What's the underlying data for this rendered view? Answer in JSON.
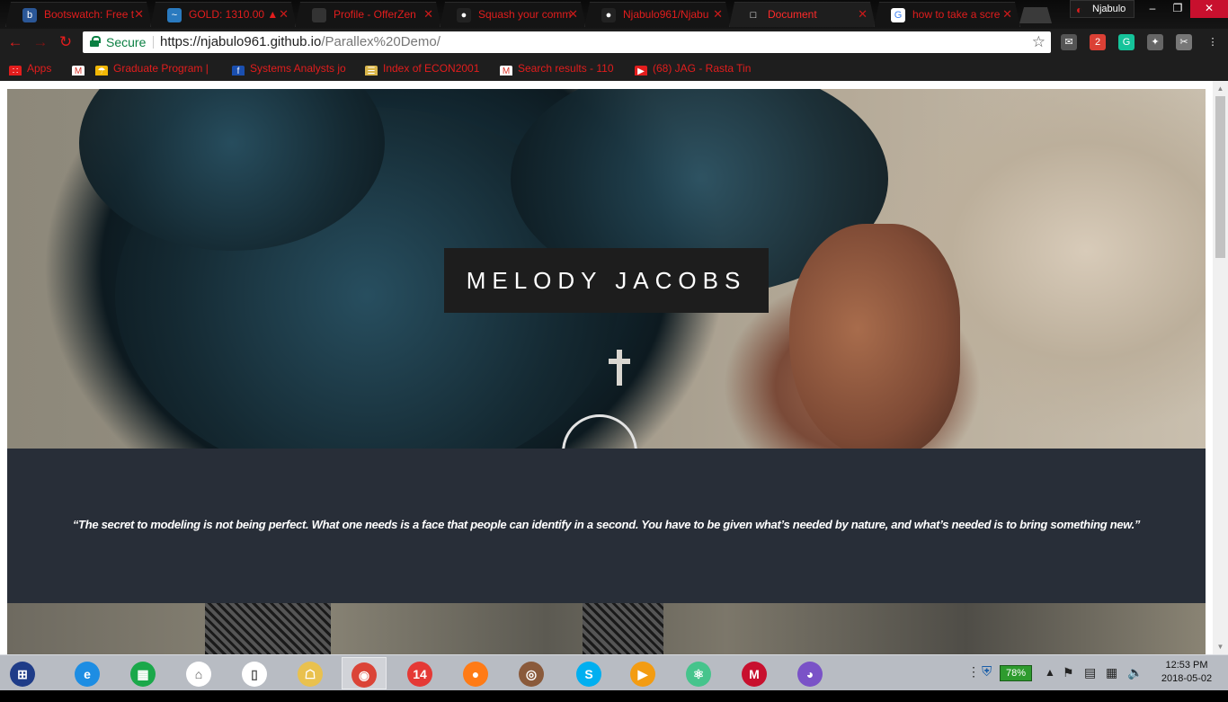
{
  "browser": {
    "tabs": [
      {
        "title": "Bootswatch: Free t",
        "icon": "bootswatch-icon",
        "color": "#2b5797",
        "glyph": "b",
        "active": false
      },
      {
        "title": "GOLD: 1310.00 ▲",
        "icon": "chart-icon",
        "color": "#2a7abf",
        "glyph": "~",
        "active": false
      },
      {
        "title": "Profile - OfferZen",
        "icon": "offerzen-icon",
        "color": "#333333",
        "glyph": "",
        "active": false
      },
      {
        "title": "Squash your comm",
        "icon": "github-icon",
        "color": "#222222",
        "glyph": "●",
        "active": false
      },
      {
        "title": "Njabulo961/Njabu",
        "icon": "github-icon",
        "color": "#222222",
        "glyph": "●",
        "active": false
      },
      {
        "title": "Document",
        "icon": "document-icon",
        "color": "#1e1e1e",
        "glyph": "□",
        "active": true
      },
      {
        "title": "how to take a scre",
        "icon": "google-icon",
        "color": "#ffffff",
        "glyph": "G",
        "active": false
      }
    ],
    "tab_close": "✕",
    "profile_name": "Njabulo",
    "window_controls": {
      "minimize": "–",
      "restore": "❐",
      "close": "✕"
    },
    "nav": {
      "back": "←",
      "forward": "→",
      "reload": "↻"
    },
    "address": {
      "secure_label": "Secure",
      "host": "https://njabulo961.github.io",
      "path": "/Parallex%20Demo/",
      "star": "☆"
    },
    "extensions": [
      {
        "name": "gmail-checker-icon",
        "glyph": "✉",
        "color": "#555555"
      },
      {
        "name": "todoist-icon",
        "glyph": "2",
        "color": "#db4035"
      },
      {
        "name": "grammarly-icon",
        "glyph": "G",
        "color": "#15c39a"
      },
      {
        "name": "extension-icon",
        "glyph": "✦",
        "color": "#666666"
      },
      {
        "name": "pdf-icon",
        "glyph": "✂",
        "color": "#777777"
      },
      {
        "name": "menu-icon",
        "glyph": "⋮",
        "color": "#1e1e1e"
      }
    ],
    "bookmarks": [
      {
        "label": "Apps",
        "icon": "apps-grid-icon",
        "color": "#e21d1d",
        "glyph": "∷"
      },
      {
        "label": "",
        "icon": "gmail-icon",
        "color": "#ffffff",
        "glyph": "M"
      },
      {
        "label": "Graduate Program |",
        "icon": "umbrella-icon",
        "color": "#f2b705",
        "glyph": "☂"
      },
      {
        "label": "Systems Analysts jo",
        "icon": "careers-icon",
        "color": "#1a4fb0",
        "glyph": "f"
      },
      {
        "label": "Index of ECON2001",
        "icon": "folder-icon",
        "color": "#d9b54a",
        "glyph": "☰"
      },
      {
        "label": "Search results - 110",
        "icon": "gmail-icon",
        "color": "#ffffff",
        "glyph": "M"
      },
      {
        "label": "(68) JAG - Rasta Tin",
        "icon": "youtube-icon",
        "color": "#e21d1d",
        "glyph": "▶"
      }
    ]
  },
  "page": {
    "hero_title": "MELODY JACOBS",
    "quote": "“The secret to modeling is not being perfect. What one needs is a face that people can identify in a second. You have to be given what’s needed by nature, and what’s needed is to bring something new.”",
    "colors": {
      "quote_bg": "#282e38",
      "title_bg": "#1d1d1d",
      "accent": "#e21d1d"
    }
  },
  "taskbar": {
    "apps": [
      {
        "name": "start-button",
        "glyph": "⊞",
        "color": "#1f3c88",
        "active": false
      },
      {
        "name": "ie-icon",
        "glyph": "e",
        "color": "#1d8de3",
        "active": false
      },
      {
        "name": "store-icon",
        "glyph": "▦",
        "color": "#1aa84a",
        "active": false
      },
      {
        "name": "home-icon",
        "glyph": "⌂",
        "color": "#ffffff",
        "active": false
      },
      {
        "name": "file-icon",
        "glyph": "▯",
        "color": "#ffffff",
        "active": false
      },
      {
        "name": "file-explorer-icon",
        "glyph": "☖",
        "color": "#e9c14e",
        "active": false
      },
      {
        "name": "chrome-icon",
        "glyph": "◉",
        "color": "#db4437",
        "active": true
      },
      {
        "name": "calendar-14-icon",
        "glyph": "14",
        "color": "#e53935",
        "active": false
      },
      {
        "name": "firefox-icon",
        "glyph": "●",
        "color": "#ff7b16",
        "active": false
      },
      {
        "name": "instagram-icon",
        "glyph": "◎",
        "color": "#8a5a3b",
        "active": false
      },
      {
        "name": "skype-icon",
        "glyph": "S",
        "color": "#00aff0",
        "active": false
      },
      {
        "name": "video-editor-icon",
        "glyph": "▶",
        "color": "#f39c12",
        "active": false
      },
      {
        "name": "atom-icon",
        "glyph": "⚛",
        "color": "#46c48c",
        "active": false
      },
      {
        "name": "mcafee-icon",
        "glyph": "M",
        "color": "#c8102e",
        "active": false
      },
      {
        "name": "cat-app-icon",
        "glyph": "◕",
        "color": "#7a52c7",
        "active": false
      }
    ],
    "battery_percent": "78%",
    "time": "12:53 PM",
    "date": "2018-05-02"
  }
}
